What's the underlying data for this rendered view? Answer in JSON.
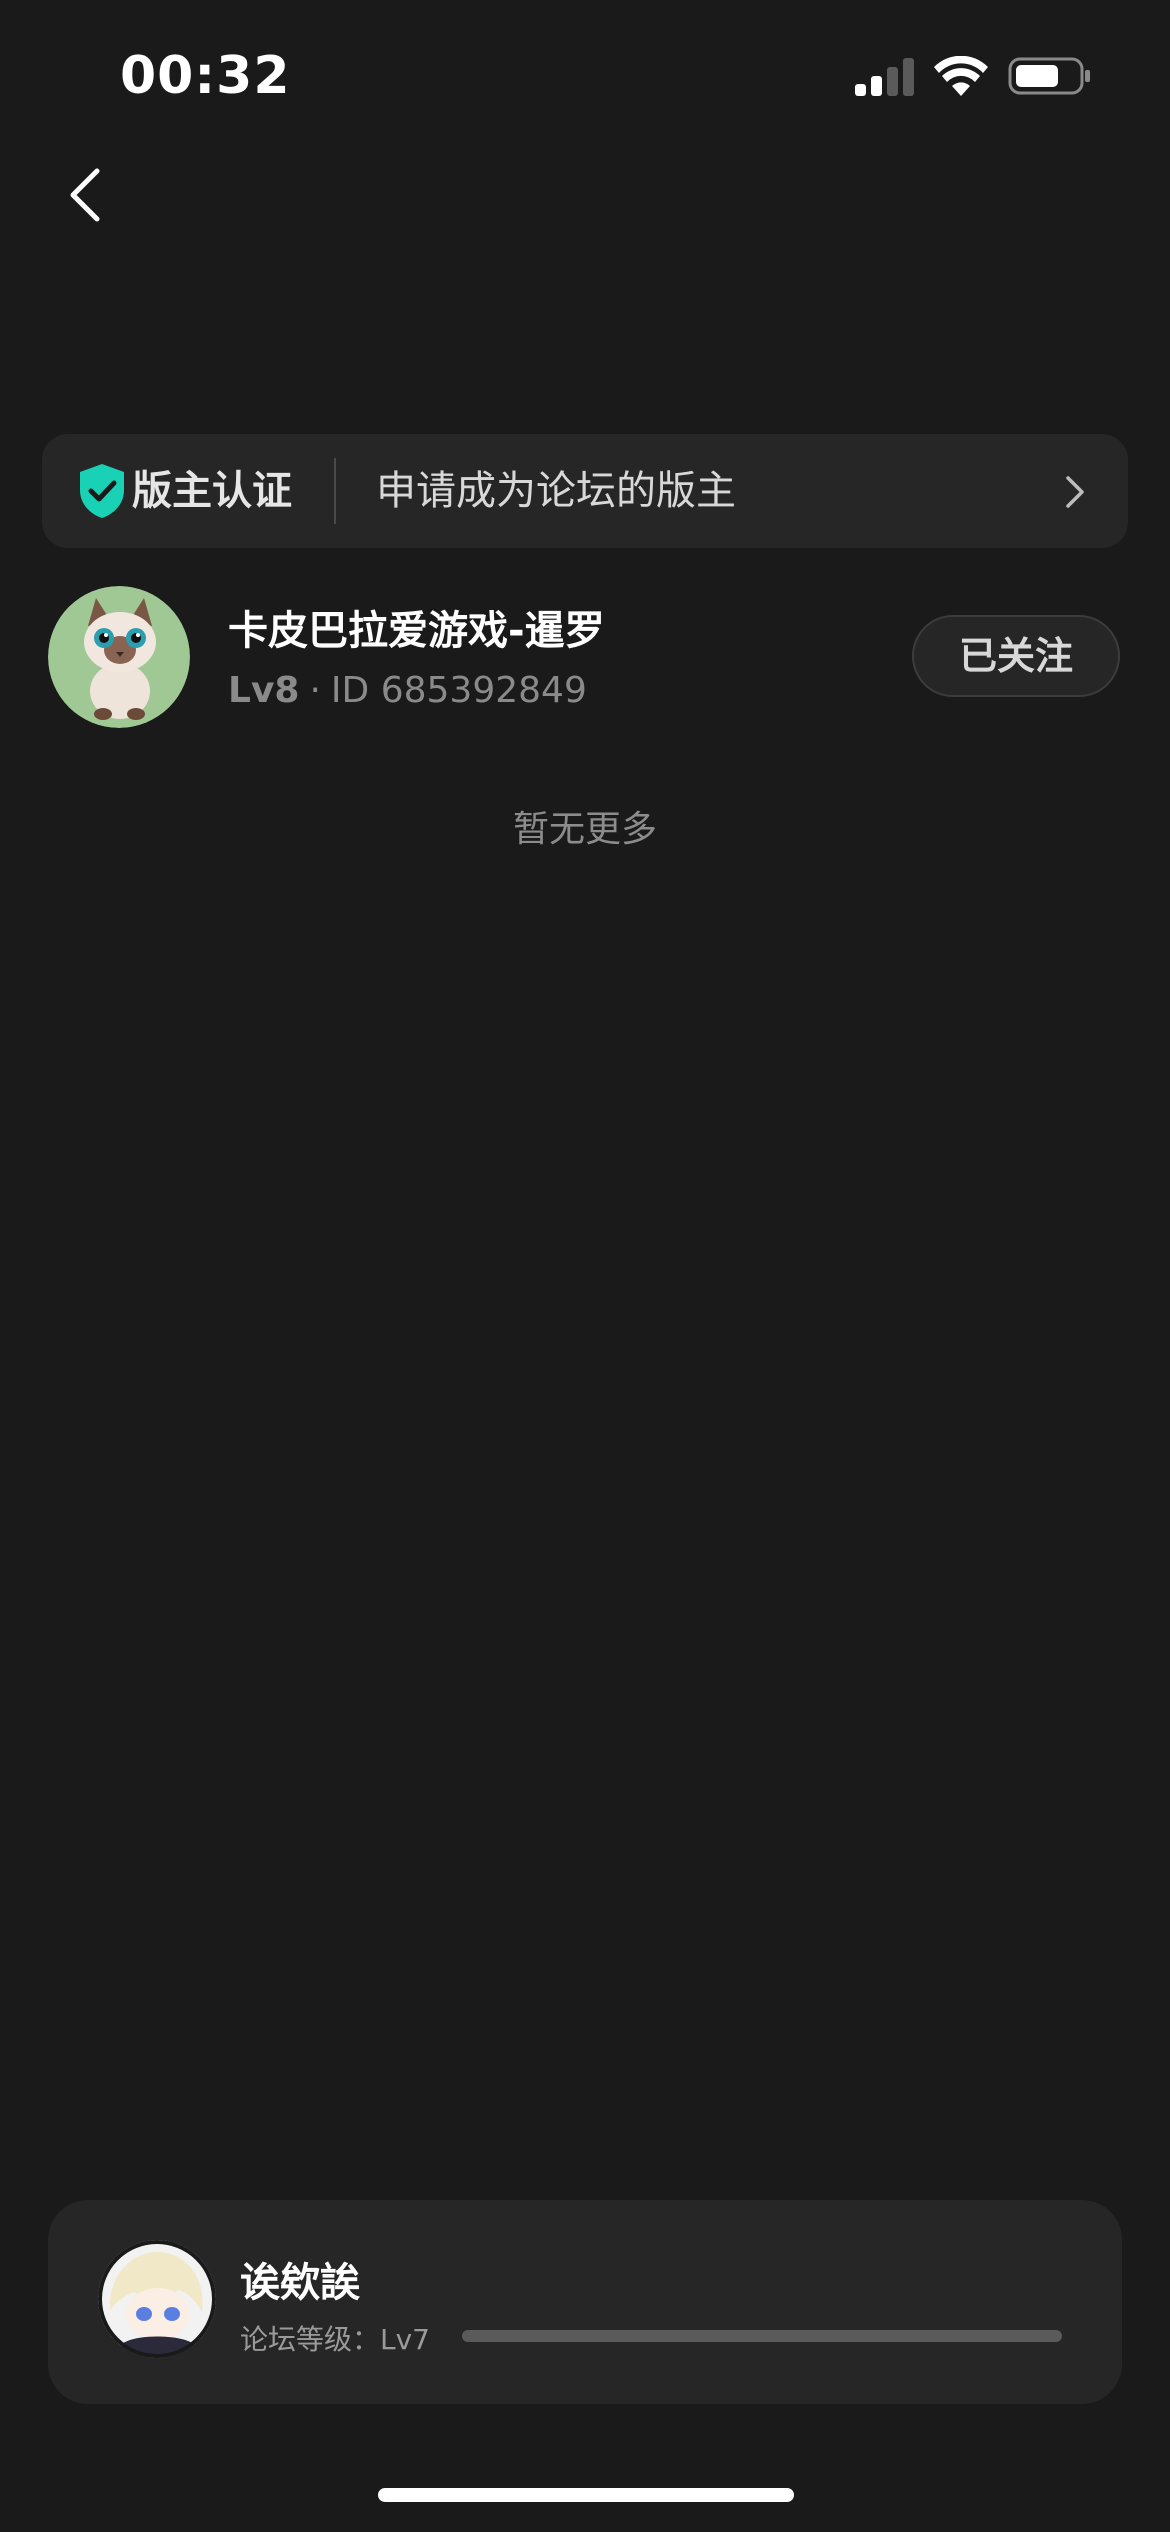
{
  "status_bar": {
    "time": "00:32",
    "signal_icon": "signal-bars-icon",
    "wifi_icon": "wifi-icon",
    "battery_icon": "battery-icon"
  },
  "nav": {
    "back_icon": "chevron-left-icon"
  },
  "moderator_banner": {
    "badge_icon": "shield-check-icon",
    "badge_label": "版主认证",
    "text": "申请成为论坛的版主",
    "chevron_icon": "chevron-right-icon",
    "accent_color": "#19d2b5"
  },
  "moderators": [
    {
      "name": "卡皮巴拉爱游戏-暹罗",
      "level": "Lv8",
      "separator": "·",
      "id_text": "ID 685392849",
      "follow_label": "已关注"
    }
  ],
  "list_end_text": "暂无更多",
  "my_card": {
    "name": "诶欸誒",
    "level_label": "论坛等级：Lv7",
    "progress": 1.0
  }
}
